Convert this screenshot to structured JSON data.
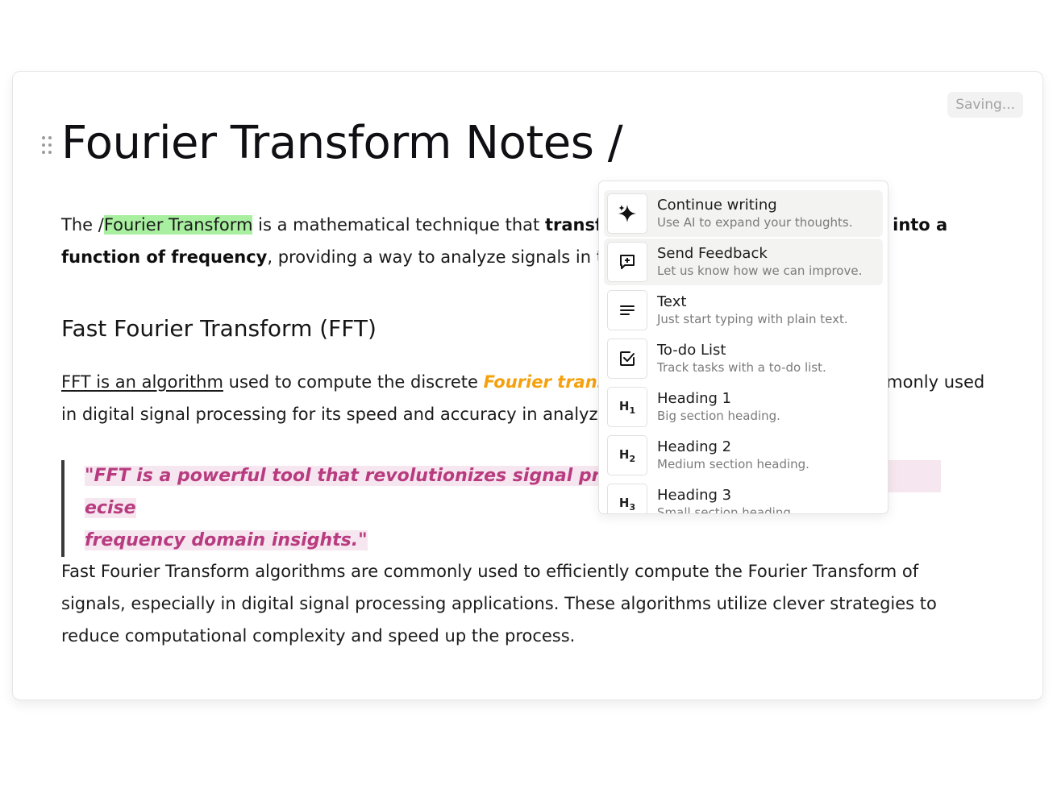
{
  "status": {
    "saving_label": "Saving..."
  },
  "document": {
    "title": "Fourier Transform Notes /",
    "intro": {
      "prefix": "The /",
      "highlight": "Fourier Transform",
      "middle": " is a mathematical technique that ",
      "bold_a": "transf",
      "bold_b": "into a",
      "line2_bold": "function of frequency",
      "line2_rest": ", providing a way to analyze signals in th"
    },
    "section_heading": "Fast Fourier Transform (FFT)",
    "fft_para": {
      "underlined": "FFT is an algorithm",
      "middle": " used to compute the discrete ",
      "emphasis": "Fourier trans",
      "tail_line1": "monly used",
      "line2": "in digital signal processing for its speed and accuracy in analyz"
    },
    "quote": {
      "line1_a": "\"FFT is a powerful tool that revolutionizes signal processin",
      "line1_b": "ecise",
      "line2": "frequency domain insights.\""
    },
    "closing": "Fast Fourier Transform algorithms are commonly used to efficiently compute the Fourier Transform of signals, especially in digital signal processing applications. These algorithms utilize clever strategies to reduce computational complexity and speed up the process."
  },
  "slash_menu": {
    "items": [
      {
        "title": "Continue writing",
        "desc": "Use AI to expand your thoughts.",
        "icon": "sparkles-icon"
      },
      {
        "title": "Send Feedback",
        "desc": "Let us know how we can improve.",
        "icon": "feedback-icon"
      },
      {
        "title": "Text",
        "desc": "Just start typing with plain text.",
        "icon": "text-icon"
      },
      {
        "title": "To-do List",
        "desc": "Track tasks with a to-do list.",
        "icon": "checkbox-icon"
      },
      {
        "title": "Heading 1",
        "desc": "Big section heading.",
        "icon": "heading1-icon",
        "glyph": "H1"
      },
      {
        "title": "Heading 2",
        "desc": "Medium section heading.",
        "icon": "heading2-icon",
        "glyph": "H2"
      },
      {
        "title": "Heading 3",
        "desc": "Small section heading.",
        "icon": "heading3-icon",
        "glyph": "H3"
      }
    ]
  },
  "colors": {
    "highlight": "#a8f0a0",
    "emphasis_orange": "#f5a00c",
    "quote_pink": "#b83b7f",
    "quote_bg": "#f6e6ef"
  }
}
